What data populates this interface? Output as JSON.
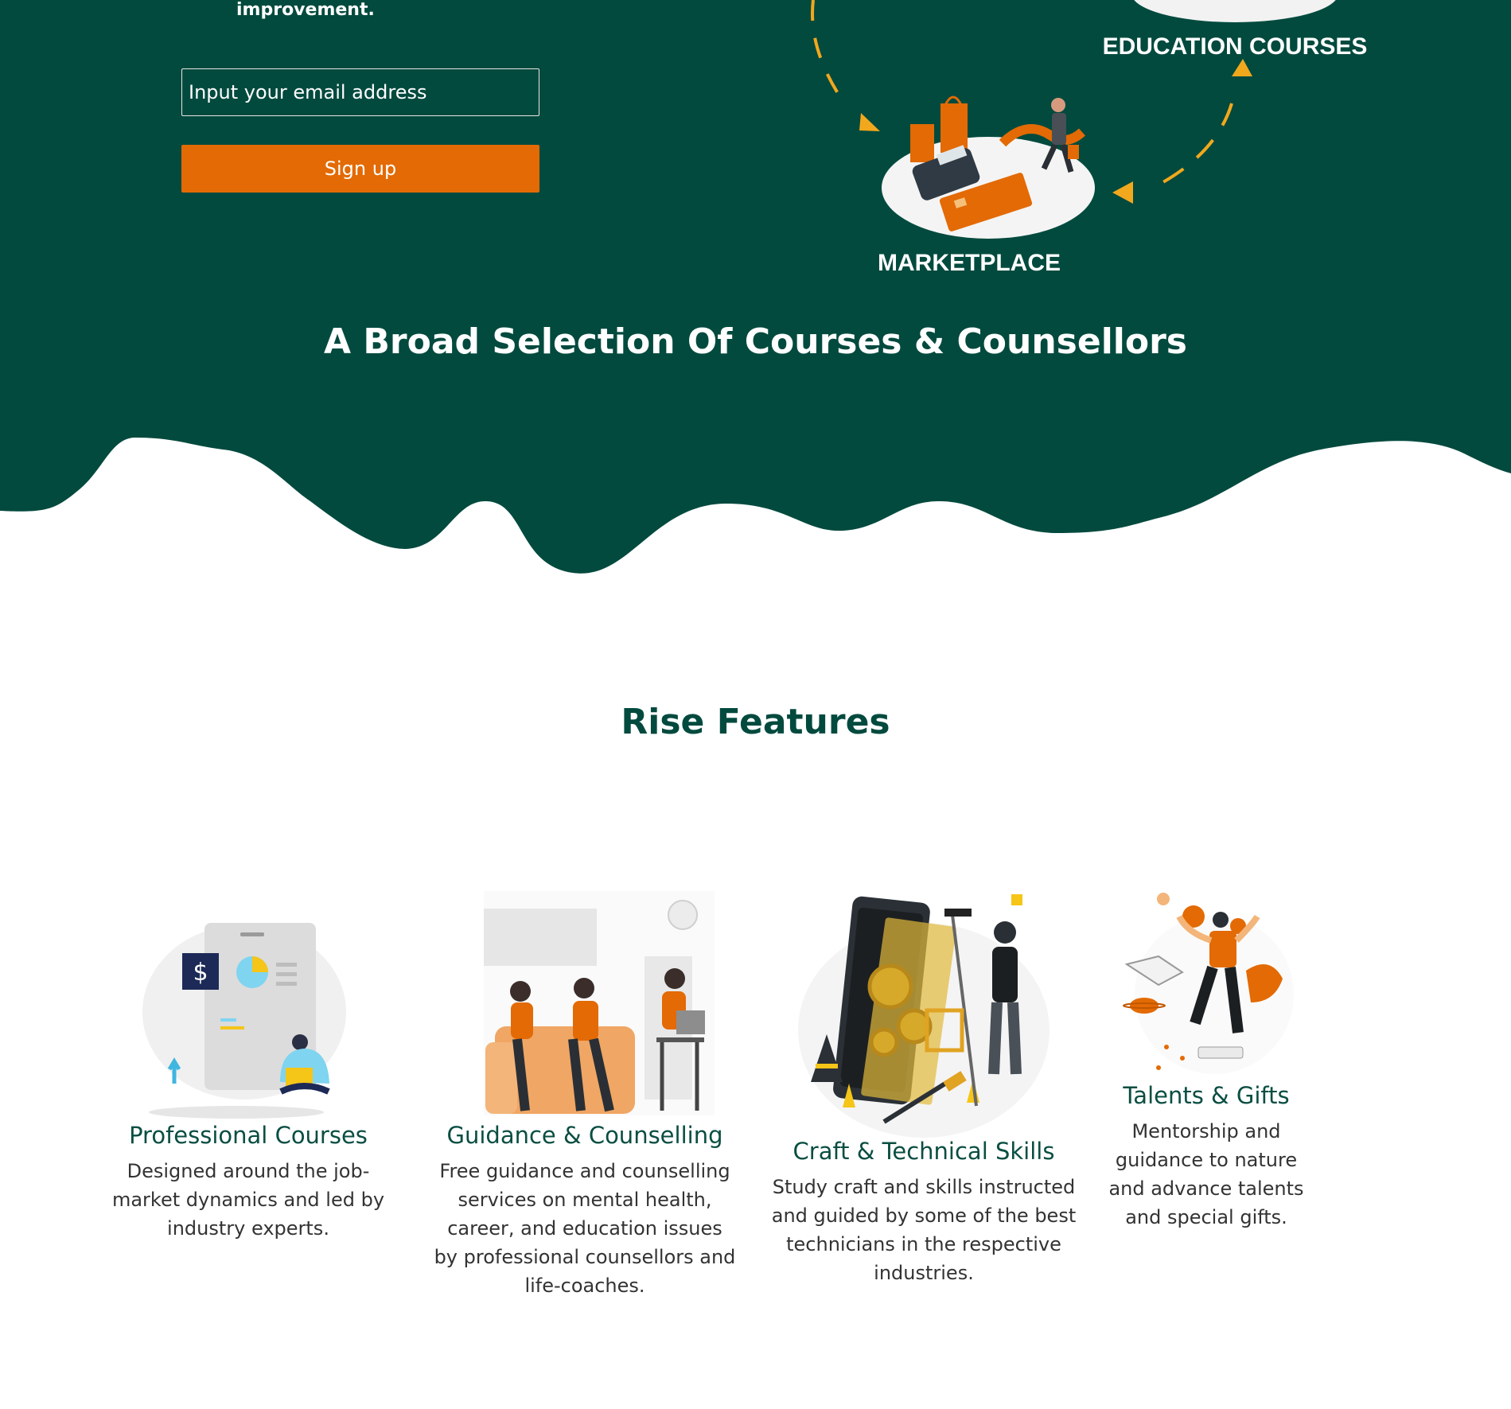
{
  "hero": {
    "tagline_tail": "improvement.",
    "email_placeholder": "Input your email address",
    "signup_label": "Sign up",
    "diagram": {
      "label_education": "EDUCATION COURSES",
      "label_marketplace": "MARKETPLACE"
    },
    "title": "A Broad Selection Of Courses & Counsellors"
  },
  "features": {
    "title": "Rise Features",
    "items": [
      {
        "title": "Professional Courses",
        "description": "Designed around the job-market dynamics and led by industry experts.",
        "icon": "professional-courses-illustration"
      },
      {
        "title": "Guidance & Counselling",
        "description": "Free guidance and counselling services on mental health, career, and education issues by professional counsellors and life-coaches.",
        "icon": "counselling-illustration"
      },
      {
        "title": "Craft & Technical Skills",
        "description": "Study craft and skills instructed and guided by some of the best technicians in the respective industries.",
        "icon": "craft-skills-illustration"
      },
      {
        "title": "Talents & Gifts",
        "description": "Mentorship and guidance to nature and advance talents and special gifts.",
        "icon": "talents-illustration"
      }
    ]
  },
  "colors": {
    "brand_green": "#024a3e",
    "accent_orange": "#e36a04",
    "arrow_yellow": "#f2a81d"
  }
}
